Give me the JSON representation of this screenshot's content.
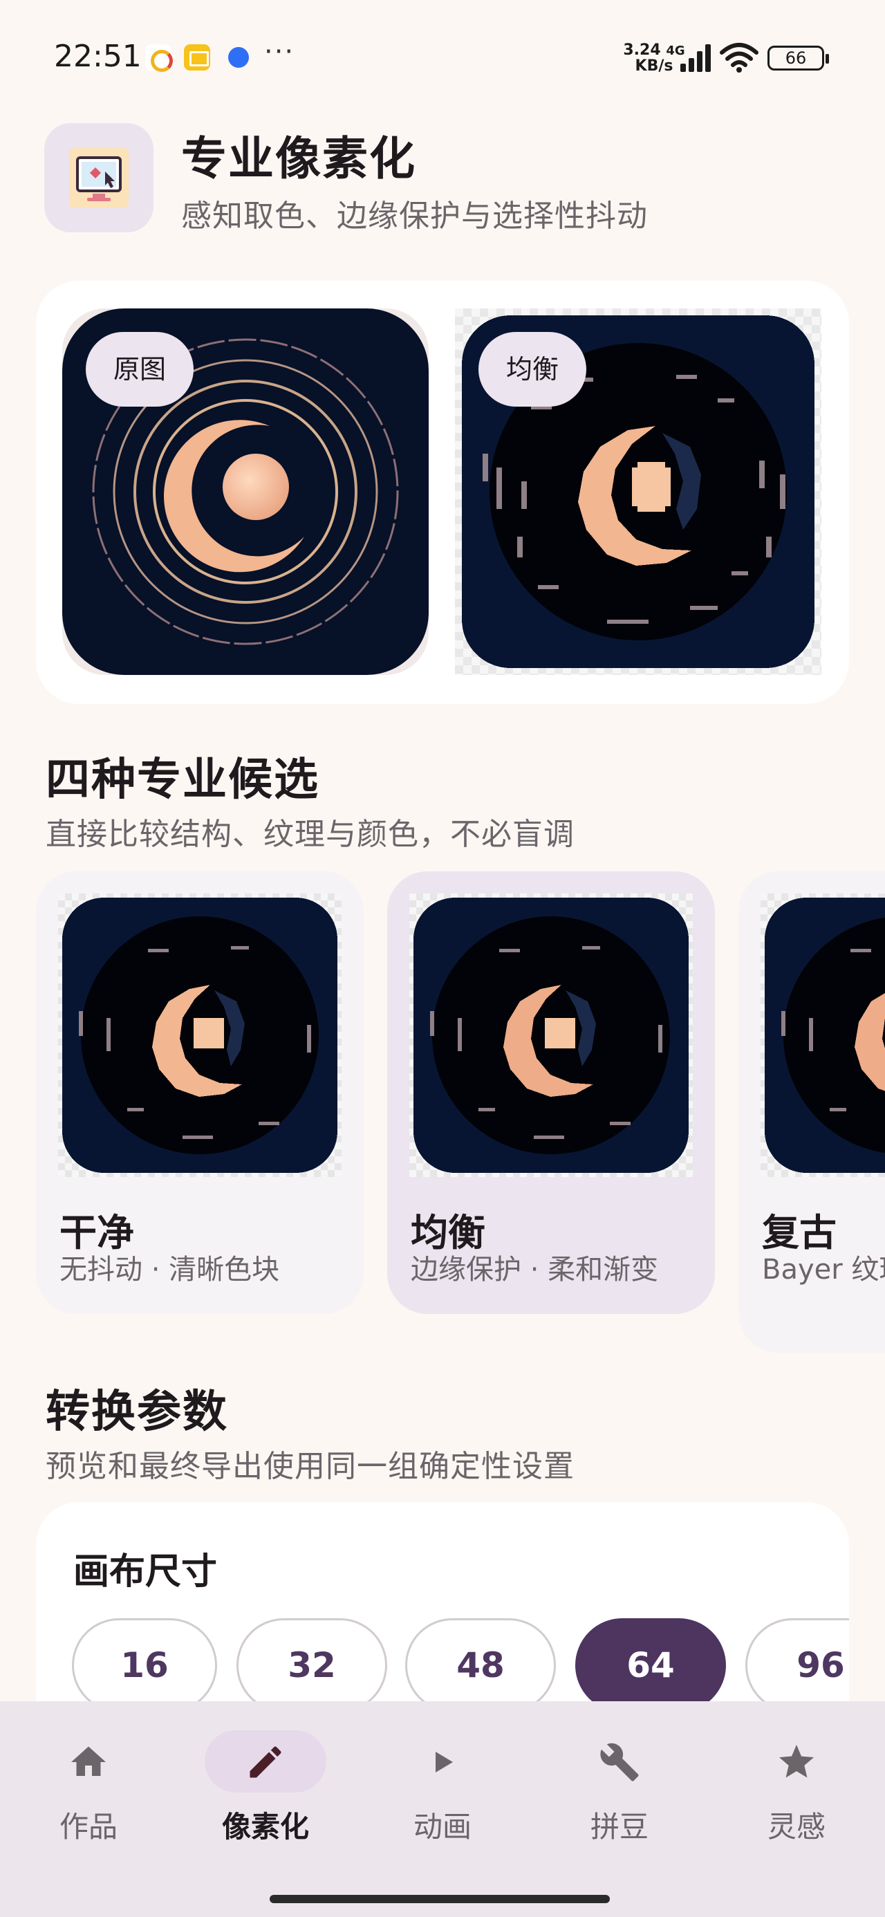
{
  "status_bar": {
    "time": "22:51",
    "more": "···",
    "net_speed_value": "3.24",
    "net_speed_unit": "KB/s",
    "network_type": "4G",
    "battery": "66",
    "icons": [
      "notification-app-icon",
      "mail-app-icon",
      "chat-app-icon",
      "signal-icon",
      "wifi-icon",
      "battery-icon"
    ]
  },
  "header": {
    "title": "专业像素化",
    "subtitle": "感知取色、边缘保护与选择性抖动",
    "icon": "pixel-art-icon"
  },
  "preview": {
    "original_label": "原图",
    "result_label": "均衡"
  },
  "candidates_section": {
    "title": "四种专业候选",
    "subtitle": "直接比较结构、纹理与颜色，不必盲调",
    "items": [
      {
        "name": "干净",
        "desc": "无抖动 · 清晰色块"
      },
      {
        "name": "均衡",
        "desc": "边缘保护 · 柔和渐变"
      },
      {
        "name": "复古",
        "desc": "Bayer 纹理 · 有序"
      }
    ]
  },
  "params_section": {
    "title": "转换参数",
    "subtitle": "预览和最终导出使用同一组确定性设置",
    "canvas_size_label": "画布尺寸",
    "sizes": [
      "16",
      "32",
      "48",
      "64",
      "96"
    ],
    "selected_size": "64"
  },
  "bottom_nav": {
    "items": [
      {
        "label": "作品",
        "icon": "home-icon"
      },
      {
        "label": "像素化",
        "icon": "pencil-icon"
      },
      {
        "label": "动画",
        "icon": "play-icon"
      },
      {
        "label": "拼豆",
        "icon": "wrench-icon"
      },
      {
        "label": "灵感",
        "icon": "star-icon"
      }
    ],
    "active": "像素化"
  },
  "colors": {
    "background": "#fcf7f3",
    "accent": "#4d3560",
    "active_pill": "#e6d9ea",
    "artwork_navy": "#071127",
    "artwork_peach": "#f2b691"
  }
}
